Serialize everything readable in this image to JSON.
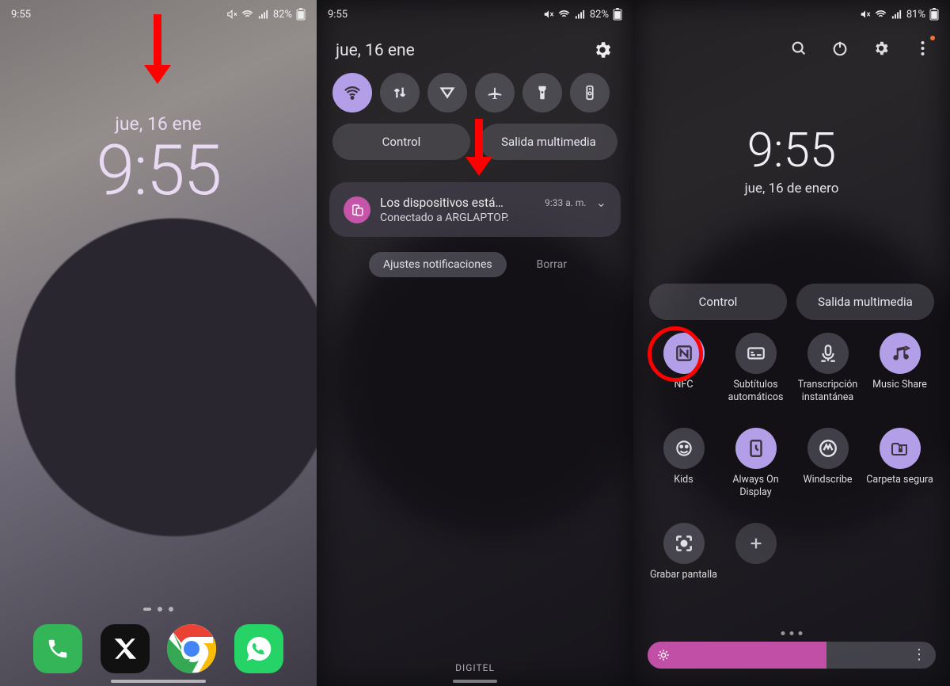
{
  "screens": {
    "home": {
      "status_time": "9:55",
      "battery": "82%",
      "date": "jue, 16 ene",
      "clock": "9:55",
      "dock": [
        {
          "name": "phone-icon"
        },
        {
          "name": "x-icon"
        },
        {
          "name": "chrome-icon"
        },
        {
          "name": "whatsapp-icon"
        }
      ]
    },
    "panel2": {
      "status_time": "9:55",
      "battery": "82%",
      "date": "jue, 16 ene",
      "qs_row": [
        {
          "name": "wifi-icon",
          "active": true
        },
        {
          "name": "data-transfer-icon",
          "active": false
        },
        {
          "name": "vpn-icon",
          "active": false
        },
        {
          "name": "airplane-icon",
          "active": false
        },
        {
          "name": "flashlight-icon",
          "active": false
        },
        {
          "name": "remote-icon",
          "active": false
        }
      ],
      "pills": {
        "control": "Control",
        "media": "Salida multimedia"
      },
      "notification": {
        "title": "Los dispositivos está…",
        "time": "9:33 a. m.",
        "subtitle": "Conectado a ARGLAPTOP."
      },
      "actions": {
        "settings": "Ajustes notificaciones",
        "clear": "Borrar"
      },
      "carrier": "DIGITEL"
    },
    "panel3": {
      "battery": "81%",
      "clock": "9:55",
      "date": "jue, 16 de enero",
      "pills": {
        "control": "Control",
        "media": "Salida multimedia"
      },
      "tiles_row1": [
        {
          "icon": "nfc-icon",
          "label": "NFC",
          "on": true
        },
        {
          "icon": "subtitles-icon",
          "label": "Subtítulos automáticos",
          "on": false
        },
        {
          "icon": "transcribe-icon",
          "label": "Transcripción instantánea",
          "on": false
        },
        {
          "icon": "music-share-icon",
          "label": "Music Share",
          "on": true
        }
      ],
      "tiles_row2": [
        {
          "icon": "kids-icon",
          "label": "Kids",
          "on": false
        },
        {
          "icon": "aod-icon",
          "label": "Always On Display",
          "on": true
        },
        {
          "icon": "windscribe-icon",
          "label": "Windscribe",
          "on": false
        },
        {
          "icon": "secure-folder-icon",
          "label": "Carpeta segura",
          "on": true
        }
      ],
      "tiles_row3": [
        {
          "icon": "screen-record-icon",
          "label": "Grabar pantalla",
          "on": false
        },
        {
          "icon": "add-icon",
          "label": "",
          "on": false
        }
      ],
      "brightness_pct": 62
    }
  }
}
